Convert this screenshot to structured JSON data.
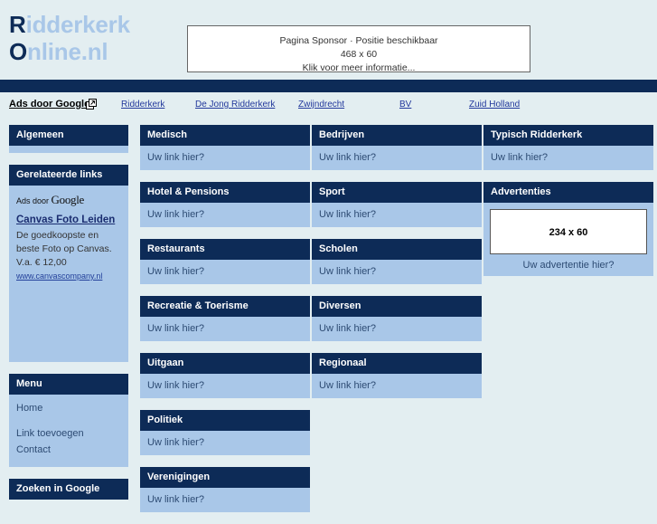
{
  "site": {
    "logo_line1_cap": "R",
    "logo_line1_rest": "idderkerk",
    "logo_line2_cap": "O",
    "logo_line2_rest": "nline.nl"
  },
  "sponsor": {
    "line1": "Pagina Sponsor · Positie beschikbaar",
    "line2": "468 x 60",
    "line3": "Klik voor meer informatie..."
  },
  "ads_bar": {
    "label": "Ads door Google",
    "icon": "external-link-icon",
    "links": [
      "Ridderkerk",
      "De Jong Ridderkerk",
      "Zwijndrecht",
      "BV",
      "Zuid Holland"
    ]
  },
  "sidebar": {
    "algemeen": {
      "title": "Algemeen"
    },
    "related": {
      "title": "Gerelateerde links",
      "attr_prefix": "Ads door",
      "attr_brand": "Google",
      "ad_title": "Canvas Foto Leiden",
      "ad_text": "De goedkoopste en beste Foto op Canvas. V.a. € 12,00",
      "ad_url": "www.canvascompany.nl"
    },
    "menu": {
      "title": "Menu",
      "items": [
        "Home",
        "Link toevoegen",
        "Contact"
      ]
    },
    "search": {
      "title": "Zoeken in Google"
    }
  },
  "placeholder_link": "Uw link hier?",
  "columns": [
    {
      "panels": [
        {
          "title": "Medisch",
          "body": "Uw link hier?"
        },
        {
          "title": "Hotel & Pensions",
          "body": "Uw link hier?"
        },
        {
          "title": "Restaurants",
          "body": "Uw link hier?"
        },
        {
          "title": "Recreatie & Toerisme",
          "body": "Uw link hier?"
        },
        {
          "title": "Uitgaan",
          "body": "Uw link hier?"
        },
        {
          "title": "Politiek",
          "body": "Uw link hier?"
        },
        {
          "title": "Verenigingen",
          "body": "Uw link hier?"
        }
      ]
    },
    {
      "panels": [
        {
          "title": "Bedrijven",
          "body": "Uw link hier?"
        },
        {
          "title": "Sport",
          "body": "Uw link hier?"
        },
        {
          "title": "Scholen",
          "body": "Uw link hier?"
        },
        {
          "title": "Diversen",
          "body": "Uw link hier?"
        },
        {
          "title": "Regionaal",
          "body": "Uw link hier?"
        }
      ]
    },
    {
      "panels": [
        {
          "title": "Typisch Ridderkerk",
          "body": "Uw link hier?"
        }
      ]
    }
  ],
  "advertenties": {
    "title": "Advertenties",
    "size_label": "234 x 60",
    "caption": "Uw advertentie hier?"
  },
  "colors": {
    "page_background": "#e3eef1",
    "navy": "#0d2b57",
    "panel_body": "#a9c7e8",
    "link_blue": "#22389c",
    "logo_light": "#a9c7e8"
  }
}
